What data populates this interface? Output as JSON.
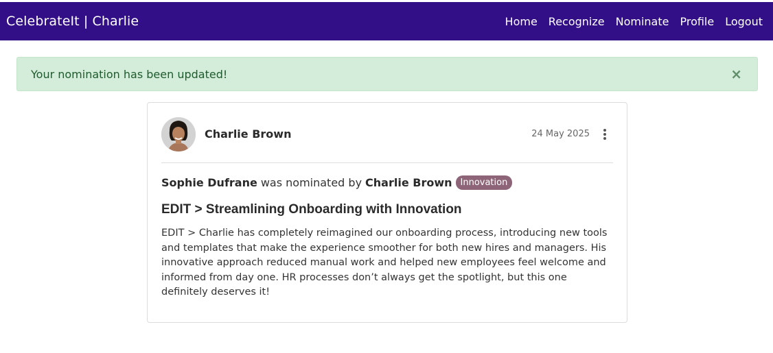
{
  "navbar": {
    "brand": "CelebrateIt | Charlie",
    "links": [
      "Home",
      "Recognize",
      "Nominate",
      "Profile",
      "Logout"
    ]
  },
  "alert": {
    "message": "Your nomination has been updated!",
    "close_symbol": "×"
  },
  "card": {
    "author_name": "Charlie Brown",
    "date": "24 May 2025",
    "nominee": "Sophie Dufrane",
    "nominated_text": "was nominated by",
    "nominator": "Charlie Brown",
    "category_badge": "Innovation",
    "title": "EDIT > Streamlining Onboarding with Innovation",
    "body": "EDIT > Charlie has completely reimagined our onboarding process, introducing new tools and templates that make the experience smoother for both new hires and managers. His innovative approach reduced manual work and helped new employees feel welcome and informed from day one. HR processes don’t always get the spotlight, but this one definitely deserves it!"
  },
  "colors": {
    "navbar_bg": "#330f87",
    "alert_bg": "#d4edda",
    "alert_text": "#1e5a2c",
    "badge_bg": "#8e6478"
  },
  "icons": {
    "menu": "kebab-menu-icon",
    "close": "close-icon",
    "avatar": "avatar"
  }
}
